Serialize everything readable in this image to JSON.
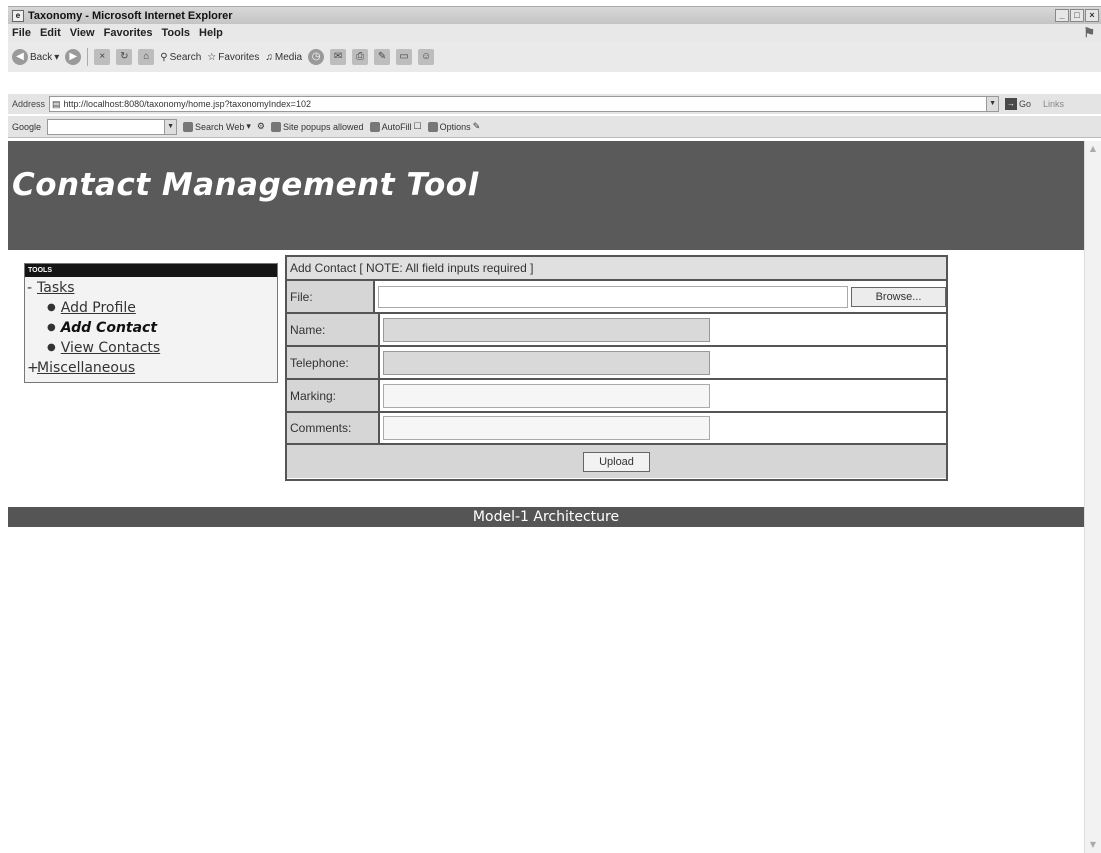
{
  "window": {
    "title": "Taxonomy - Microsoft Internet Explorer"
  },
  "menu": [
    "File",
    "Edit",
    "View",
    "Favorites",
    "Tools",
    "Help"
  ],
  "toolbar": {
    "back": "Back",
    "search": "Search",
    "favorites": "Favorites",
    "media": "Media"
  },
  "address": {
    "label": "Address",
    "url": "http://localhost:8080/taxonomy/home.jsp?taxonomyIndex=102",
    "go": "Go",
    "links": "Links"
  },
  "google_bar": {
    "logo": "Google",
    "search_web": "Search Web",
    "popups": "Site popups allowed",
    "autofill": "AutoFill",
    "options": "Options"
  },
  "banner": {
    "title": "Contact Management Tool"
  },
  "tools": {
    "header": "TOOLS",
    "tasks_label": "Tasks",
    "tasks_toggle": "-",
    "items": [
      {
        "label": "Add Profile",
        "current": false
      },
      {
        "label": "Add Contact",
        "current": true
      },
      {
        "label": "View Contacts",
        "current": false
      }
    ],
    "misc_label": "Miscellaneous",
    "misc_toggle": "+"
  },
  "form": {
    "caption": "Add Contact [ NOTE: All field inputs required ]",
    "fields": {
      "file_label": "File:",
      "name_label": "Name:",
      "telephone_label": "Telephone:",
      "marking_label": "Marking:",
      "comments_label": "Comments:"
    },
    "browse_label": "Browse...",
    "upload_label": "Upload"
  },
  "footer": {
    "text": "Model-1 Architecture"
  }
}
